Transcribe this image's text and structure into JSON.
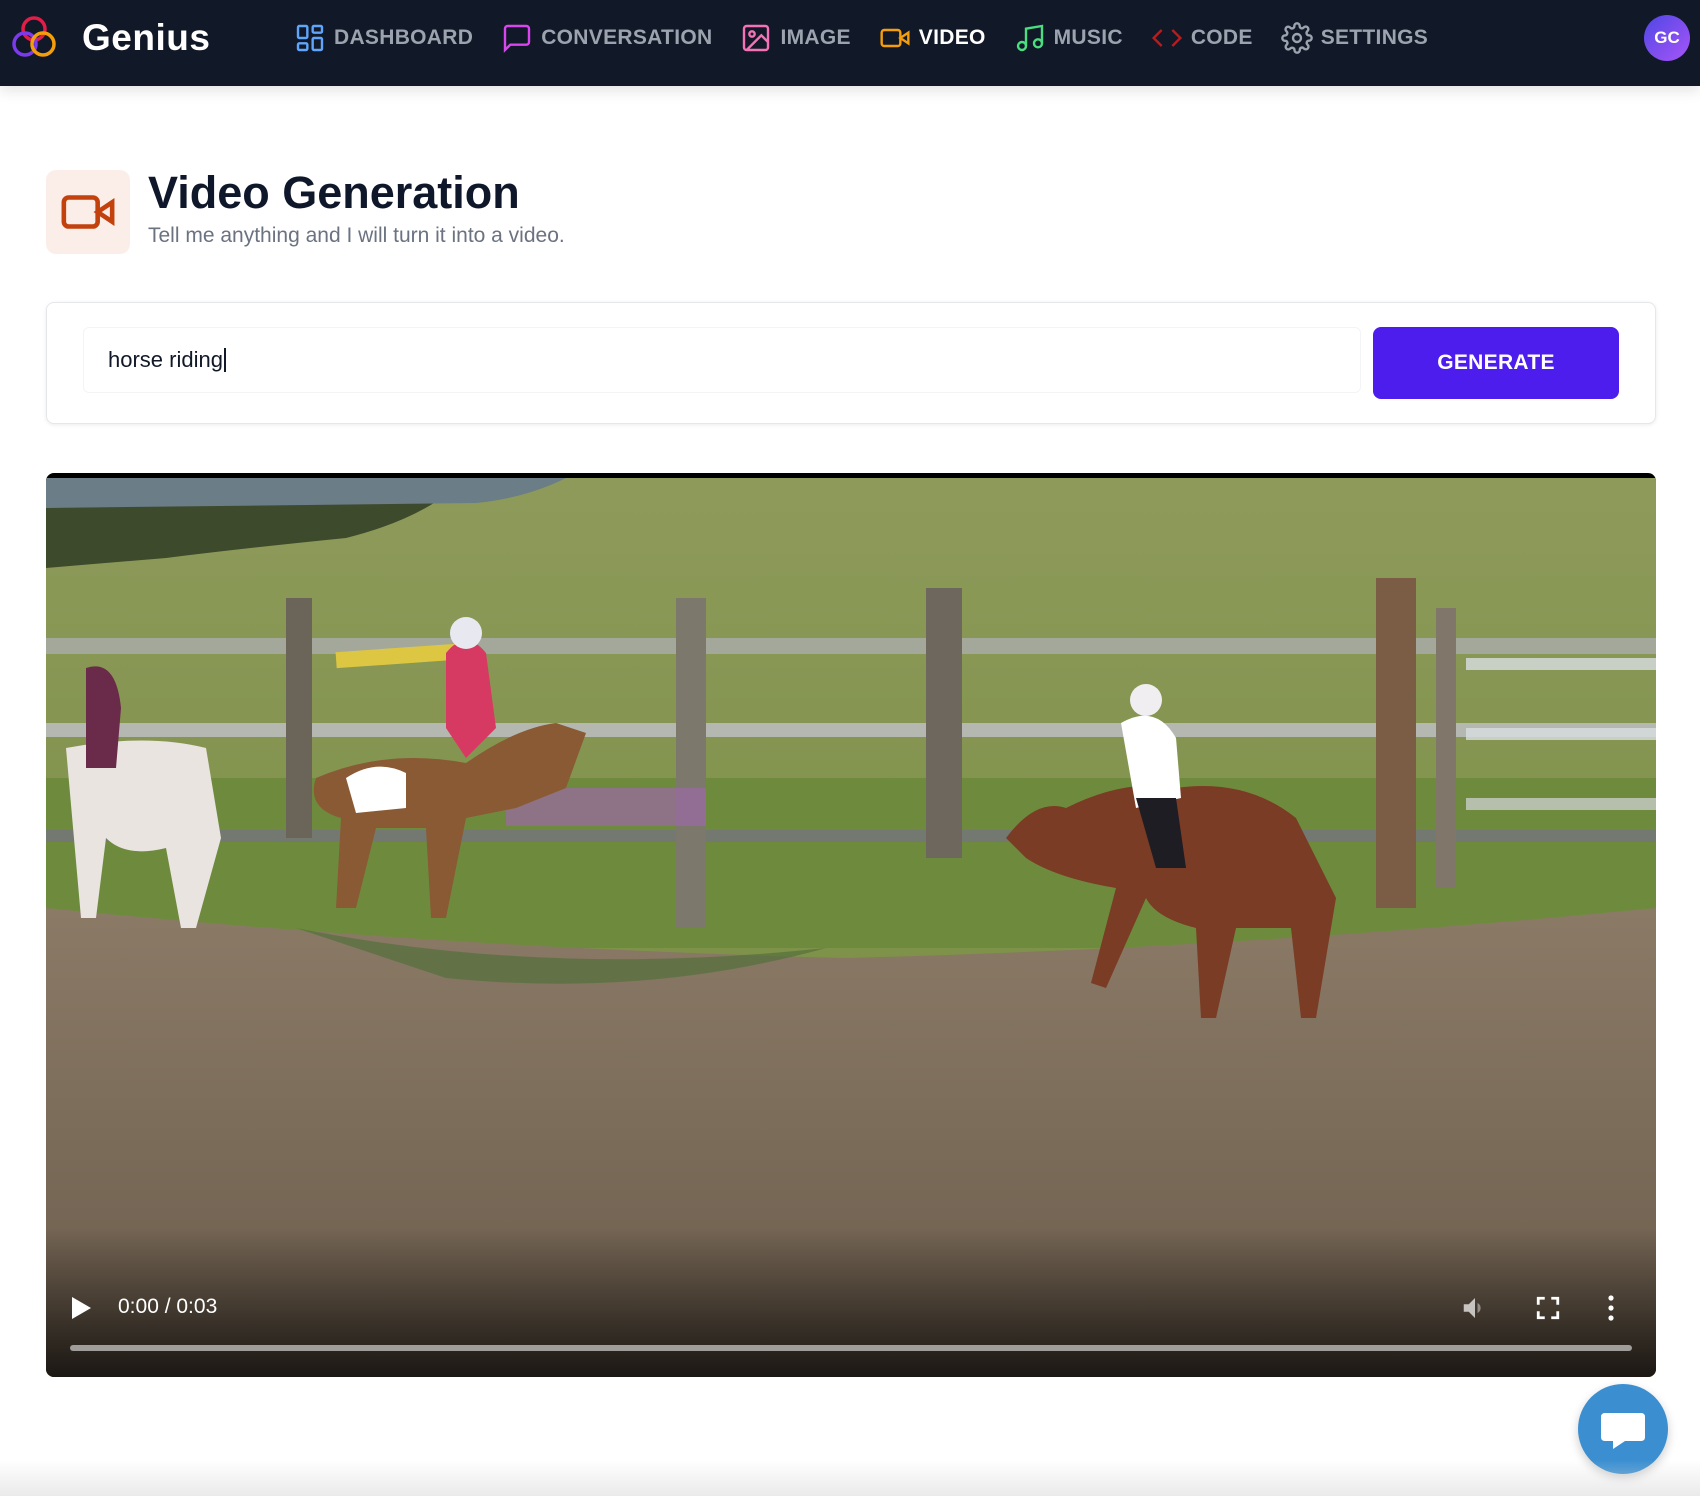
{
  "app": {
    "name": "Genius"
  },
  "nav": {
    "items": [
      {
        "label": "DASHBOARD",
        "icon": "layout-grid-icon",
        "color": "#60a5fa"
      },
      {
        "label": "CONVERSATION",
        "icon": "message-square-icon",
        "color": "#d946ef"
      },
      {
        "label": "IMAGE",
        "icon": "image-icon",
        "color": "#f472b6"
      },
      {
        "label": "VIDEO",
        "icon": "video-icon",
        "color": "#f59e0b",
        "active": true
      },
      {
        "label": "MUSIC",
        "icon": "music-icon",
        "color": "#4ade80"
      },
      {
        "label": "CODE",
        "icon": "code-icon",
        "color": "#b91c1c"
      },
      {
        "label": "SETTINGS",
        "icon": "settings-icon",
        "color": "#9ca3af"
      }
    ],
    "avatar_initials": "GC"
  },
  "page": {
    "title": "Video Generation",
    "subtitle": "Tell me anything and I will turn it into a video.",
    "icon": "video-icon",
    "accent": "#c2410c"
  },
  "form": {
    "prompt_value": "horse riding",
    "generate_label": "GENERATE",
    "button_color": "#4c1ded"
  },
  "video": {
    "time_display": "0:00 / 0:03",
    "progress": 0,
    "muted": true
  },
  "chat": {
    "icon": "chat-bubble-icon",
    "color": "#3b8fd1"
  }
}
